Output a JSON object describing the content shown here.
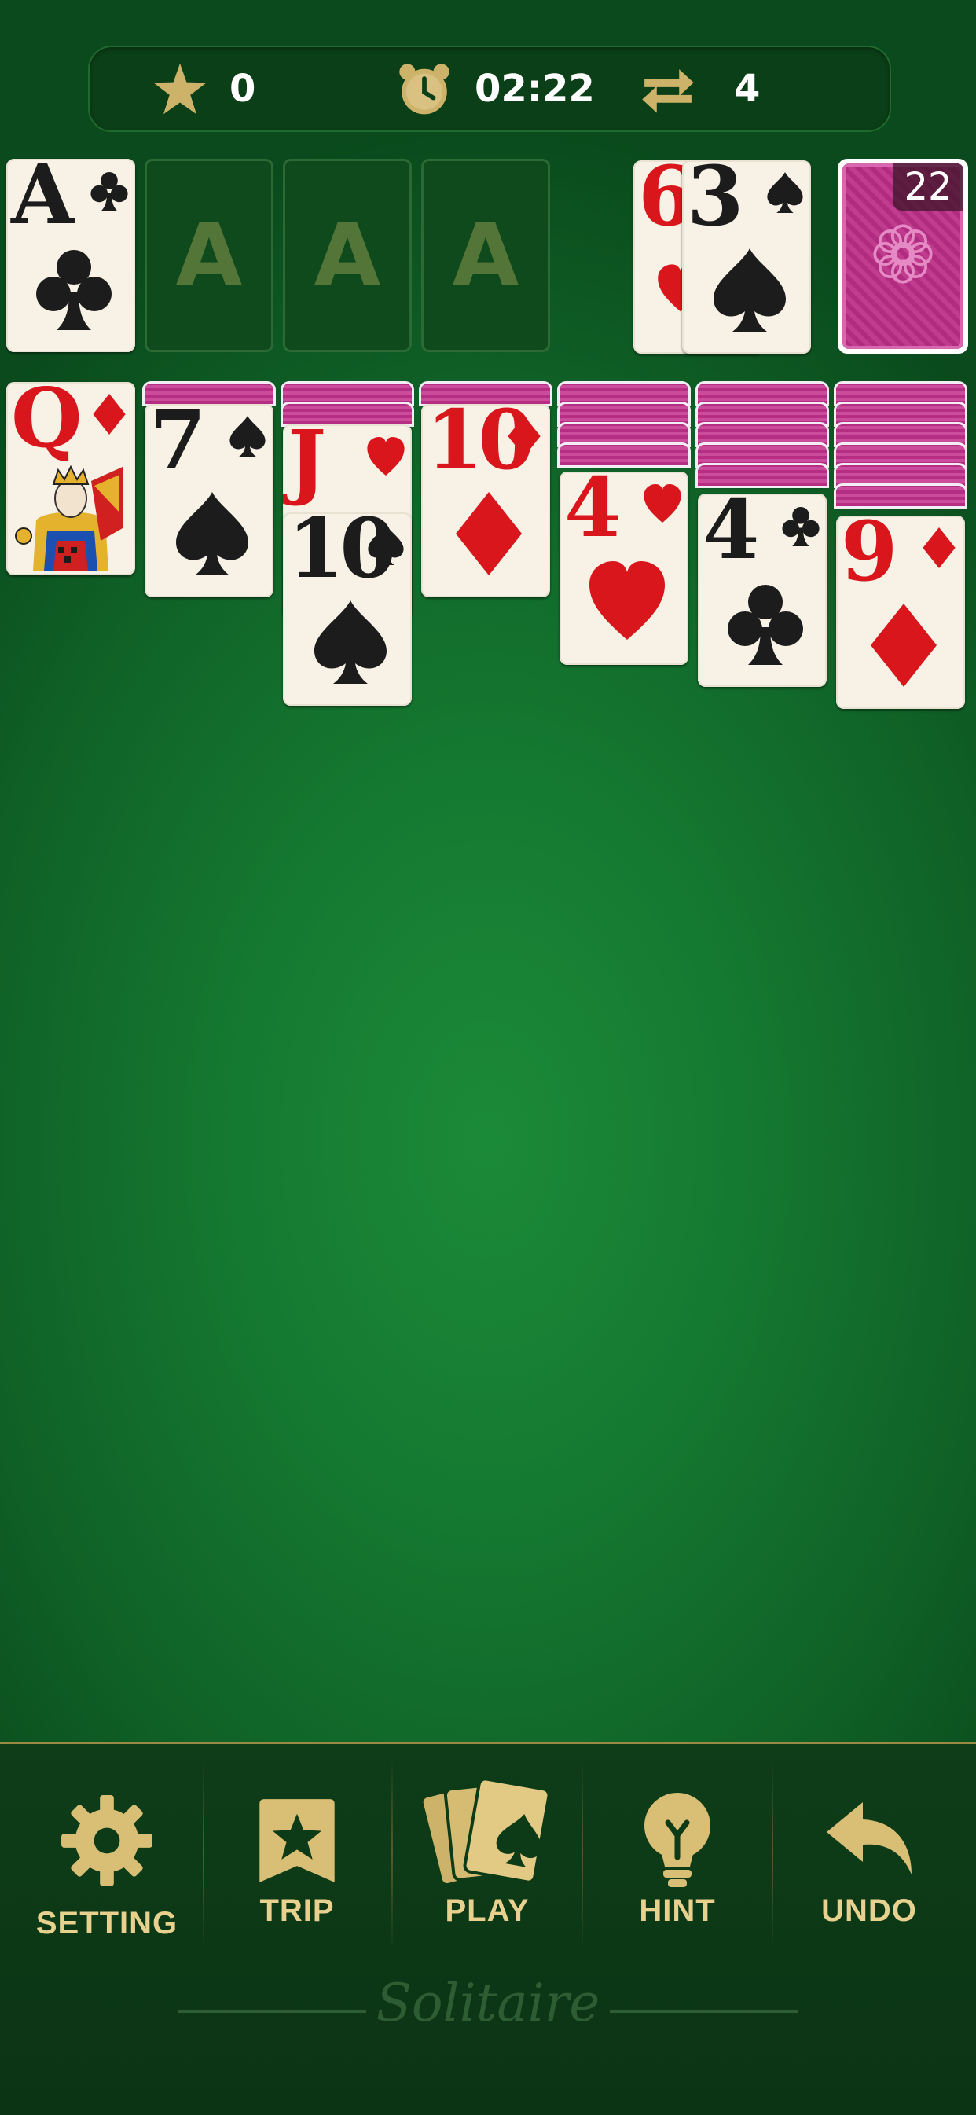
{
  "status": {
    "score": "0",
    "time": "02:22",
    "moves": "4"
  },
  "foundation_label": "A",
  "foundations": [
    {
      "rank": "A",
      "suit": "clubs",
      "filled": true
    },
    {
      "rank": "A",
      "filled": false
    },
    {
      "rank": "A",
      "filled": false
    },
    {
      "rank": "A",
      "filled": false
    }
  ],
  "waste": [
    {
      "rank": "6",
      "suit": "hearts"
    },
    {
      "rank": "3",
      "suit": "spades"
    }
  ],
  "stock": {
    "count": "22"
  },
  "tableau": [
    {
      "hidden": 0,
      "cards": [
        {
          "rank": "Q",
          "suit": "diamonds",
          "face": "queen"
        }
      ]
    },
    {
      "hidden": 1,
      "cards": [
        {
          "rank": "7",
          "suit": "spades"
        }
      ]
    },
    {
      "hidden": 2,
      "cards": [
        {
          "rank": "J",
          "suit": "hearts"
        },
        {
          "rank": "10",
          "suit": "spades"
        }
      ]
    },
    {
      "hidden": 1,
      "cards": [
        {
          "rank": "10",
          "suit": "diamonds"
        }
      ]
    },
    {
      "hidden": 4,
      "cards": [
        {
          "rank": "4",
          "suit": "hearts"
        }
      ]
    },
    {
      "hidden": 5,
      "cards": [
        {
          "rank": "4",
          "suit": "clubs"
        }
      ]
    },
    {
      "hidden": 6,
      "cards": [
        {
          "rank": "9",
          "suit": "diamonds"
        }
      ]
    }
  ],
  "toolbar": {
    "setting": "SETTING",
    "trip": "TRIP",
    "play": "PLAY",
    "hint": "HINT",
    "undo": "UNDO"
  },
  "brand": "Solitaire",
  "colors": {
    "felt": "#157a31",
    "gold": "#e8d18e",
    "card_back": "#b62e83",
    "red_suit": "#d8161c"
  },
  "icons": [
    "star-icon",
    "alarm-clock-icon",
    "swap-arrows-icon",
    "gear-icon",
    "ribbon-star-icon",
    "cards-icon",
    "lightbulb-icon",
    "undo-arrow-icon"
  ]
}
